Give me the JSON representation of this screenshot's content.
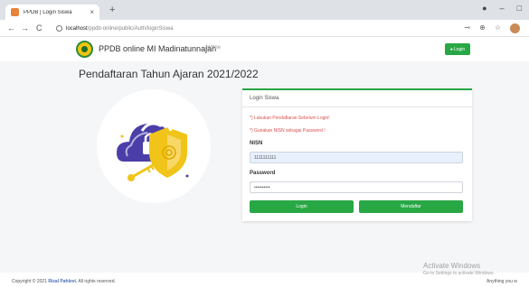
{
  "browser": {
    "tab_title": "PPDB | Login Siswa",
    "tab_close": "×",
    "new_tab": "+",
    "url_host": "localhost",
    "url_path": "/ppdb-online/public/Auth/loginSiswa",
    "back": "←",
    "forward": "→",
    "reload": "C"
  },
  "navbar": {
    "brand": "PPDB online MI Madinatunnajah",
    "home": "Home",
    "login_label": "Login"
  },
  "page": {
    "title": "Pendaftaran Tahun Ajaran 2021/2022"
  },
  "login_card": {
    "header": "Login Siswa",
    "note1": "*) Lakukan Pendaftaran Sebelum Login!",
    "note2": "*) Gunakan NISN sebagai Password !",
    "nisn_label": "NISN",
    "nisn_value": "1111111111",
    "password_label": "Password",
    "password_value": "••••••••••",
    "login_button": "Login",
    "daftar_button": "Mendaftar"
  },
  "footer": {
    "prefix": "Copyright © 2021",
    "author": "Rizal Pahlevi.",
    "suffix": "All rights reserved."
  },
  "watermark": {
    "title": "Activate Windows",
    "subtitle": "Go to Settings to activate Windows.",
    "anything": "Anything you w"
  },
  "colors": {
    "accent": "#28a745",
    "note": "#d9534f",
    "illus_purple": "#4b3ea8",
    "illus_yellow": "#f0c419"
  }
}
